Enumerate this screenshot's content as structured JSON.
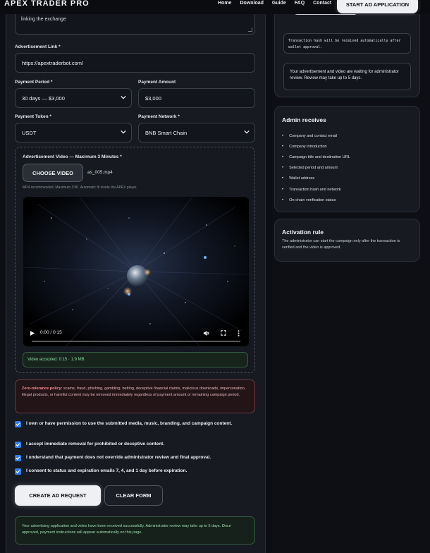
{
  "nav": {
    "brand": "APEX TRADER PRO",
    "links": [
      "Home",
      "Download",
      "Guide",
      "FAQ",
      "Contact"
    ],
    "cta": "START AD APPLICATION"
  },
  "form": {
    "textarea_tail": "linking the exchange",
    "ad_link": {
      "label": "Advertisement Link *",
      "value": "https://apextraderbot.com/"
    },
    "period": {
      "label": "Payment Period *",
      "value": "30 days — $3,000"
    },
    "amount": {
      "label": "Payment Amount",
      "value": "$3,000"
    },
    "token": {
      "label": "Payment Token *",
      "value": "USDT"
    },
    "network": {
      "label": "Payment Network *",
      "value": "BNB Smart Chain"
    },
    "video": {
      "label": "Advertisement Video — Maximum 3 Minutes *",
      "choose_label": "CHOOSE VIDEO",
      "file_name": "as_005.mp4",
      "hint": "MP4 recommended. Maximum 3:00. Automatic fit inside the APEX player.",
      "time": "0:00 / 0:15",
      "accepted": "Video accepted: 0:15 · 1.9 MB"
    },
    "policy": {
      "title": "Zero-tolerance policy:",
      "text": "scams, fraud, phishing, gambling, betting, deceptive financial claims, malicious downloads, impersonation, illegal products, or harmful content may be removed immediately regardless of payment amount or remaining campaign period."
    },
    "checks": [
      "I own or have permission to use the submitted media, music, branding, and campaign content.",
      "I accept immediate removal for prohibited or deceptive content.",
      "I understand that payment does not override administrator review and final approval.",
      "I consent to status and expiration emails 7, 4, and 1 day before expiration."
    ],
    "create_label": "CREATE AD REQUEST",
    "clear_label": "CLEAR FORM",
    "success": "Your advertising application and video have been received successfully. Administrator review may take up to 5 days. Once approved, payment instructions will appear automatically on this page."
  },
  "wallet": {
    "tx_note": "Transaction hash will be received automatically after wallet approval.",
    "awaiting": "Your advertisement and video are waiting for administrator review. Review may take up to 5 days."
  },
  "admin": {
    "title": "Admin receives",
    "items": [
      "Company and contact email",
      "Company introduction",
      "Campaign title and destination URL",
      "Selected period and amount",
      "Wallet address",
      "Transaction hash and network",
      "On-chain verification status"
    ]
  },
  "activation": {
    "title": "Activation rule",
    "text": "The administrator can start the campaign only after the transaction is verified and the video is approved."
  },
  "colors": {
    "accent": "#2f7ff0",
    "success": "#8fd6a4",
    "danger": "#ff8a95"
  }
}
